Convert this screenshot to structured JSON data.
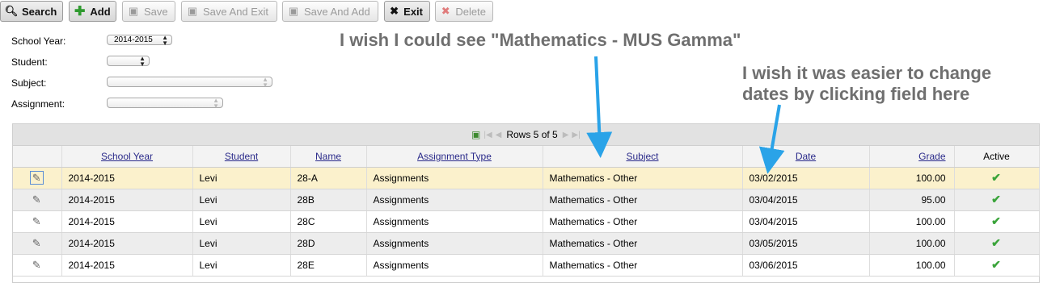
{
  "toolbar": {
    "search": "Search",
    "add": "Add",
    "save": "Save",
    "save_exit": "Save And Exit",
    "save_add": "Save And Add",
    "exit": "Exit",
    "delete": "Delete"
  },
  "form": {
    "school_year_label": "School Year:",
    "school_year_value": "2014-2015",
    "student_label": "Student:",
    "student_value": "",
    "subject_label": "Subject:",
    "subject_value": "",
    "assignment_label": "Assignment:",
    "assignment_value": ""
  },
  "pager": {
    "text": "Rows 5 of 5"
  },
  "grid": {
    "columns": [
      "School Year",
      "Student",
      "Name",
      "Assignment Type",
      "Subject",
      "Date",
      "Grade",
      "Active"
    ],
    "rows": [
      {
        "year": "2014-2015",
        "student": "Levi",
        "name": "28-A",
        "type": "Assignments",
        "subject": "Mathematics - Other",
        "date": "03/02/2015",
        "grade": "100.00",
        "active": "✔"
      },
      {
        "year": "2014-2015",
        "student": "Levi",
        "name": "28B",
        "type": "Assignments",
        "subject": "Mathematics - Other",
        "date": "03/04/2015",
        "grade": "95.00",
        "active": "✔"
      },
      {
        "year": "2014-2015",
        "student": "Levi",
        "name": "28C",
        "type": "Assignments",
        "subject": "Mathematics - Other",
        "date": "03/04/2015",
        "grade": "100.00",
        "active": "✔"
      },
      {
        "year": "2014-2015",
        "student": "Levi",
        "name": "28D",
        "type": "Assignments",
        "subject": "Mathematics - Other",
        "date": "03/05/2015",
        "grade": "100.00",
        "active": "✔"
      },
      {
        "year": "2014-2015",
        "student": "Levi",
        "name": "28E",
        "type": "Assignments",
        "subject": "Mathematics - Other",
        "date": "03/06/2015",
        "grade": "100.00",
        "active": "✔"
      }
    ]
  },
  "annotations": {
    "note1": "I wish I could see \"Mathematics - MUS Gamma\"",
    "note2_line1": "I wish it was easier to change",
    "note2_line2": "dates by clicking field here"
  },
  "colors": {
    "arrow": "#2aa3e8",
    "selected_row": "#fbf1cc",
    "check": "#3aa43a"
  }
}
